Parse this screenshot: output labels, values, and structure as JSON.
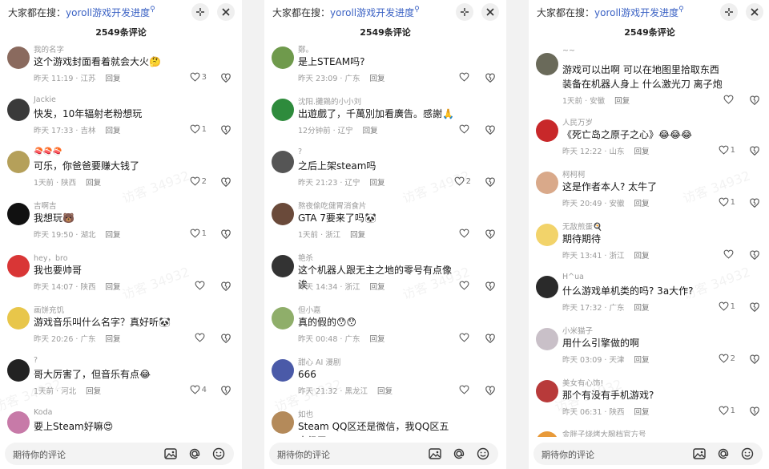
{
  "search_prefix": "大家都在搜：",
  "search_query": "yoroll游戏开发进度",
  "comment_count": "2549条评论",
  "input_placeholder": "期待你的评论",
  "reply_label": "回复",
  "watermark": "访客 34932",
  "colors": {
    "accent": "#3b62c4",
    "meta": "#9a9a9a",
    "bg": "#ffffff"
  },
  "panels": [
    {
      "comments": [
        {
          "name": "我的名字",
          "text": "这个游戏封面看着就会大火",
          "emoji": "🤔",
          "time": "昨天 11:19 · 江苏",
          "likes": "3",
          "avatar": "#8a6a5e"
        },
        {
          "name": "Jackie",
          "text": "快发，10年辐射老粉想玩",
          "emoji": "",
          "time": "昨天 17:33 · 吉林",
          "likes": "1",
          "avatar": "#3a3a3a"
        },
        {
          "name": "🍣🍣🍣",
          "text": "可乐，你爸爸要赚大钱了",
          "emoji": "",
          "time": "1天前 · 陕西",
          "likes": "2",
          "avatar": "#b5a05a"
        },
        {
          "name": "吉啊吉",
          "text": "我想玩",
          "emoji": "🐻",
          "time": "昨天 19:50 · 湖北",
          "likes": "1",
          "avatar": "#111111"
        },
        {
          "name": "hey，bro",
          "text": "我也要帅哥",
          "emoji": "",
          "time": "昨天 14:07 · 陕西",
          "likes": "",
          "avatar": "#d93636"
        },
        {
          "name": "画饼充饥",
          "text": "游戏音乐叫什么名字？真好听",
          "emoji": "🐼",
          "time": "昨天 20:26 · 广东",
          "likes": "",
          "avatar": "#e8c64a"
        },
        {
          "name": "?",
          "text": "哥大厉害了，但音乐有点",
          "emoji": "😂",
          "time": "1天前 · 河北",
          "likes": "4",
          "avatar": "#222222"
        },
        {
          "name": "Koda",
          "text": "要上Steam好嘛",
          "emoji": "😍",
          "time": "",
          "likes": "",
          "avatar": "#c77aa8"
        }
      ]
    },
    {
      "comments": [
        {
          "name": "鄭。",
          "text": "是上STEAM吗?",
          "emoji": "",
          "time": "昨天 23:09 · 广东",
          "likes": "",
          "avatar": "#6f9a4c"
        },
        {
          "name": "沈阳.攤鶏的小小刘",
          "text": "出遊戲了，千萬別加看廣告。感謝",
          "emoji": "🙏",
          "time": "12分钟前 · 辽宁",
          "likes": "",
          "avatar": "#2e8b3c"
        },
        {
          "name": "?",
          "text": "之后上架steam吗",
          "emoji": "",
          "time": "昨天 21:23 · 辽宁",
          "likes": "2",
          "avatar": "#555555"
        },
        {
          "name": "熬夜偷吃健胃消食片",
          "text": "GTA 7要来了吗",
          "emoji": "🐼",
          "time": "1天前 · 浙江",
          "likes": "",
          "avatar": "#6a4a3a"
        },
        {
          "name": "艳杀",
          "text": "这个机器人跟无主之地的零号有点像诶",
          "emoji": "",
          "time": "昨天 14:34 · 浙江",
          "likes": "",
          "avatar": "#333333"
        },
        {
          "name": "但小嘉",
          "text": "真的假的",
          "emoji": "😯😯",
          "time": "昨天 00:48 · 广东",
          "likes": "",
          "avatar": "#8fae6a"
        },
        {
          "name": "甜心 AI 漫剧",
          "text": "666",
          "emoji": "",
          "time": "昨天 21:32 · 黑龙江",
          "likes": "",
          "avatar": "#4a5aa8"
        },
        {
          "name": "如也",
          "text": "Steam QQ区还是微信，我QQ区五十级了",
          "emoji": "",
          "time": "",
          "likes": "",
          "avatar": "#b48a5a"
        }
      ]
    },
    {
      "comments": [
        {
          "name": "~~",
          "text": "游戏可以出啊 可以在地图里拾取东西装备在机器人身上 什么激光刀 离子炮",
          "emoji": "",
          "time": "1天前 · 安徽",
          "likes": "",
          "avatar": "#6a6a5a"
        },
        {
          "name": "人民万岁",
          "text": "《死亡岛之原子之心》",
          "emoji": "😂😂😂",
          "time": "昨天 12:22 · 山东",
          "likes": "1",
          "avatar": "#c8282a"
        },
        {
          "name": "柯柯柯",
          "text": "这是作者本人? 太牛了",
          "emoji": "",
          "time": "昨天 20:49 · 安徽",
          "likes": "1",
          "avatar": "#d9a98a"
        },
        {
          "name": "无敌煎蛋🍳",
          "text": "期待期待",
          "emoji": "",
          "time": "昨天 13:41 · 浙江",
          "likes": "",
          "avatar": "#f2d36a"
        },
        {
          "name": "H^ua",
          "text": "什么游戏单机类的吗? 3a大作?",
          "emoji": "",
          "time": "昨天 17:32 · 广东",
          "likes": "1",
          "avatar": "#2a2a2a"
        },
        {
          "name": "小米猫子",
          "text": "用什么引擎做的啊",
          "emoji": "",
          "time": "昨天 03:09 · 天津",
          "likes": "2",
          "avatar": "#c9c0c8"
        },
        {
          "name": "美女有心饰!",
          "text": "那个有没有手机游戏?",
          "emoji": "",
          "time": "昨天 06:31 · 陕西",
          "likes": "1",
          "avatar": "#b83a3a"
        },
        {
          "name": "金胖子烧烤大腕档官方号",
          "text": "",
          "emoji": "",
          "time": "",
          "likes": "",
          "avatar": "#e89a3a"
        }
      ]
    }
  ]
}
